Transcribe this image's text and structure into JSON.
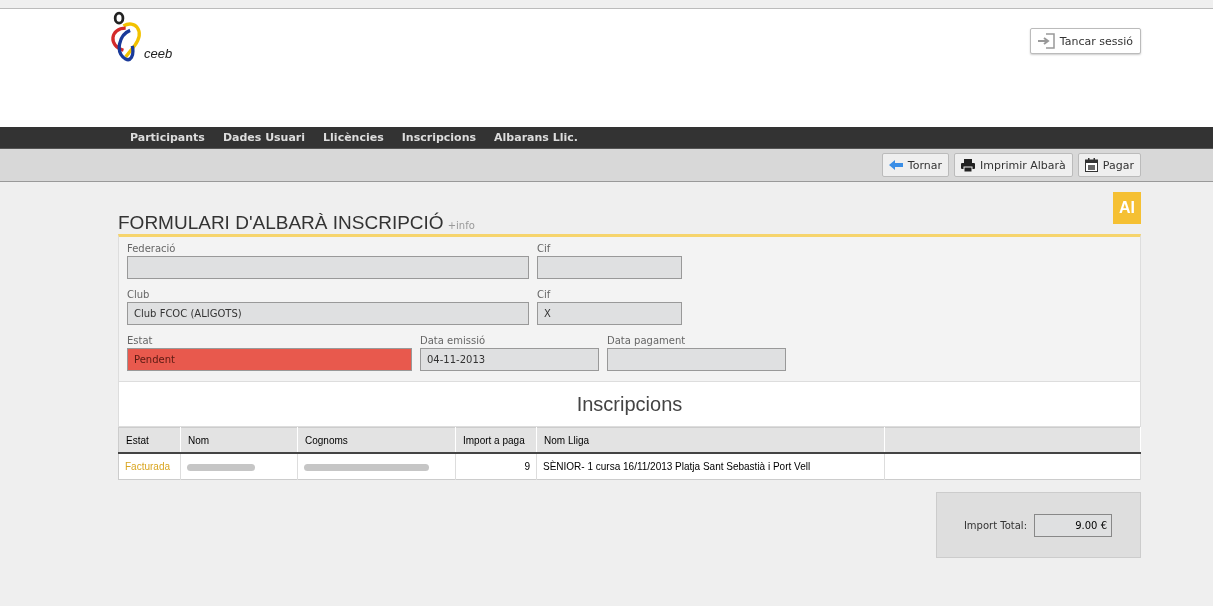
{
  "logo": {
    "text": "ceeb"
  },
  "logout_button": "Tancar sessió",
  "nav": [
    {
      "label": "Participants"
    },
    {
      "label": "Dades Usuari"
    },
    {
      "label": "Llicències"
    },
    {
      "label": "Inscripcions"
    },
    {
      "label": "Albarans Llic."
    }
  ],
  "toolbar": [
    {
      "kind": "back",
      "label": "Tornar"
    },
    {
      "kind": "print",
      "label": "Imprimir Albarà"
    },
    {
      "kind": "pay",
      "label": "Pagar"
    }
  ],
  "title": "FORMULARI D'ALBARÀ INSCRIPCIÓ",
  "info_link": "+info",
  "badge": "AI",
  "form_rows": [
    [
      {
        "label": "Federació",
        "kind": "normal"
      },
      {
        "label": "Cif",
        "kind": "normal"
      }
    ],
    [
      {
        "label": "Club",
        "value": "Club FCOC (ALIGOTS)",
        "kind": "normal"
      },
      {
        "label": "Cif",
        "value": "X",
        "kind": "normal"
      }
    ],
    [
      {
        "label": "Estat",
        "value": "Pendent",
        "kind": "alert"
      },
      {
        "label": "Data emissió",
        "value": "04-11-2013",
        "kind": "normal"
      },
      {
        "label": "Data pagament",
        "kind": "normal"
      }
    ]
  ],
  "table": {
    "title": "Inscripcions",
    "columns": [
      "Estat",
      "Nom",
      "Cognoms",
      "Import a paga",
      "Nom Lliga",
      ""
    ],
    "rows": [
      {
        "estat": "Facturada",
        "nom_redacted": true,
        "cognoms_redacted": true,
        "import": "9",
        "lliga": "SÈNIOR- 1 cursa 16/11/2013 Platja Sant Sebastià i Port Vell"
      }
    ]
  },
  "total": {
    "label": "Import Total:",
    "value": "9.00 €"
  }
}
